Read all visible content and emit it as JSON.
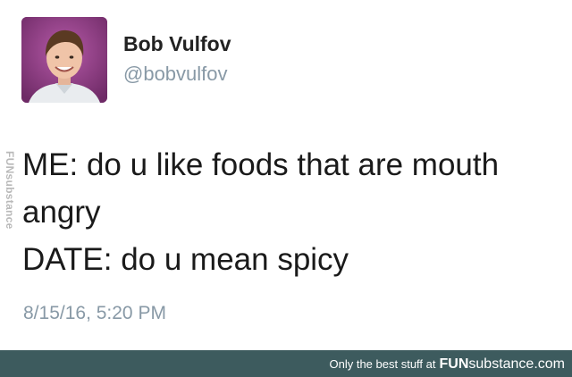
{
  "watermark": {
    "side_text": "FUNsubstance"
  },
  "tweet": {
    "display_name": "Bob Vulfov",
    "handle": "@bobvulfov",
    "lines": [
      "ME: do u like foods that are mouth",
      "angry",
      "DATE: do u mean spicy"
    ],
    "timestamp": "8/15/16, 5:20 PM"
  },
  "footer": {
    "tagline": "Only the best stuff at",
    "brand_fun": "FUN",
    "brand_substance": "substance.com"
  },
  "colors": {
    "avatar_background": "#8a3d80",
    "footer_background": "#3d5b5e",
    "secondary_text": "#8899a6"
  }
}
